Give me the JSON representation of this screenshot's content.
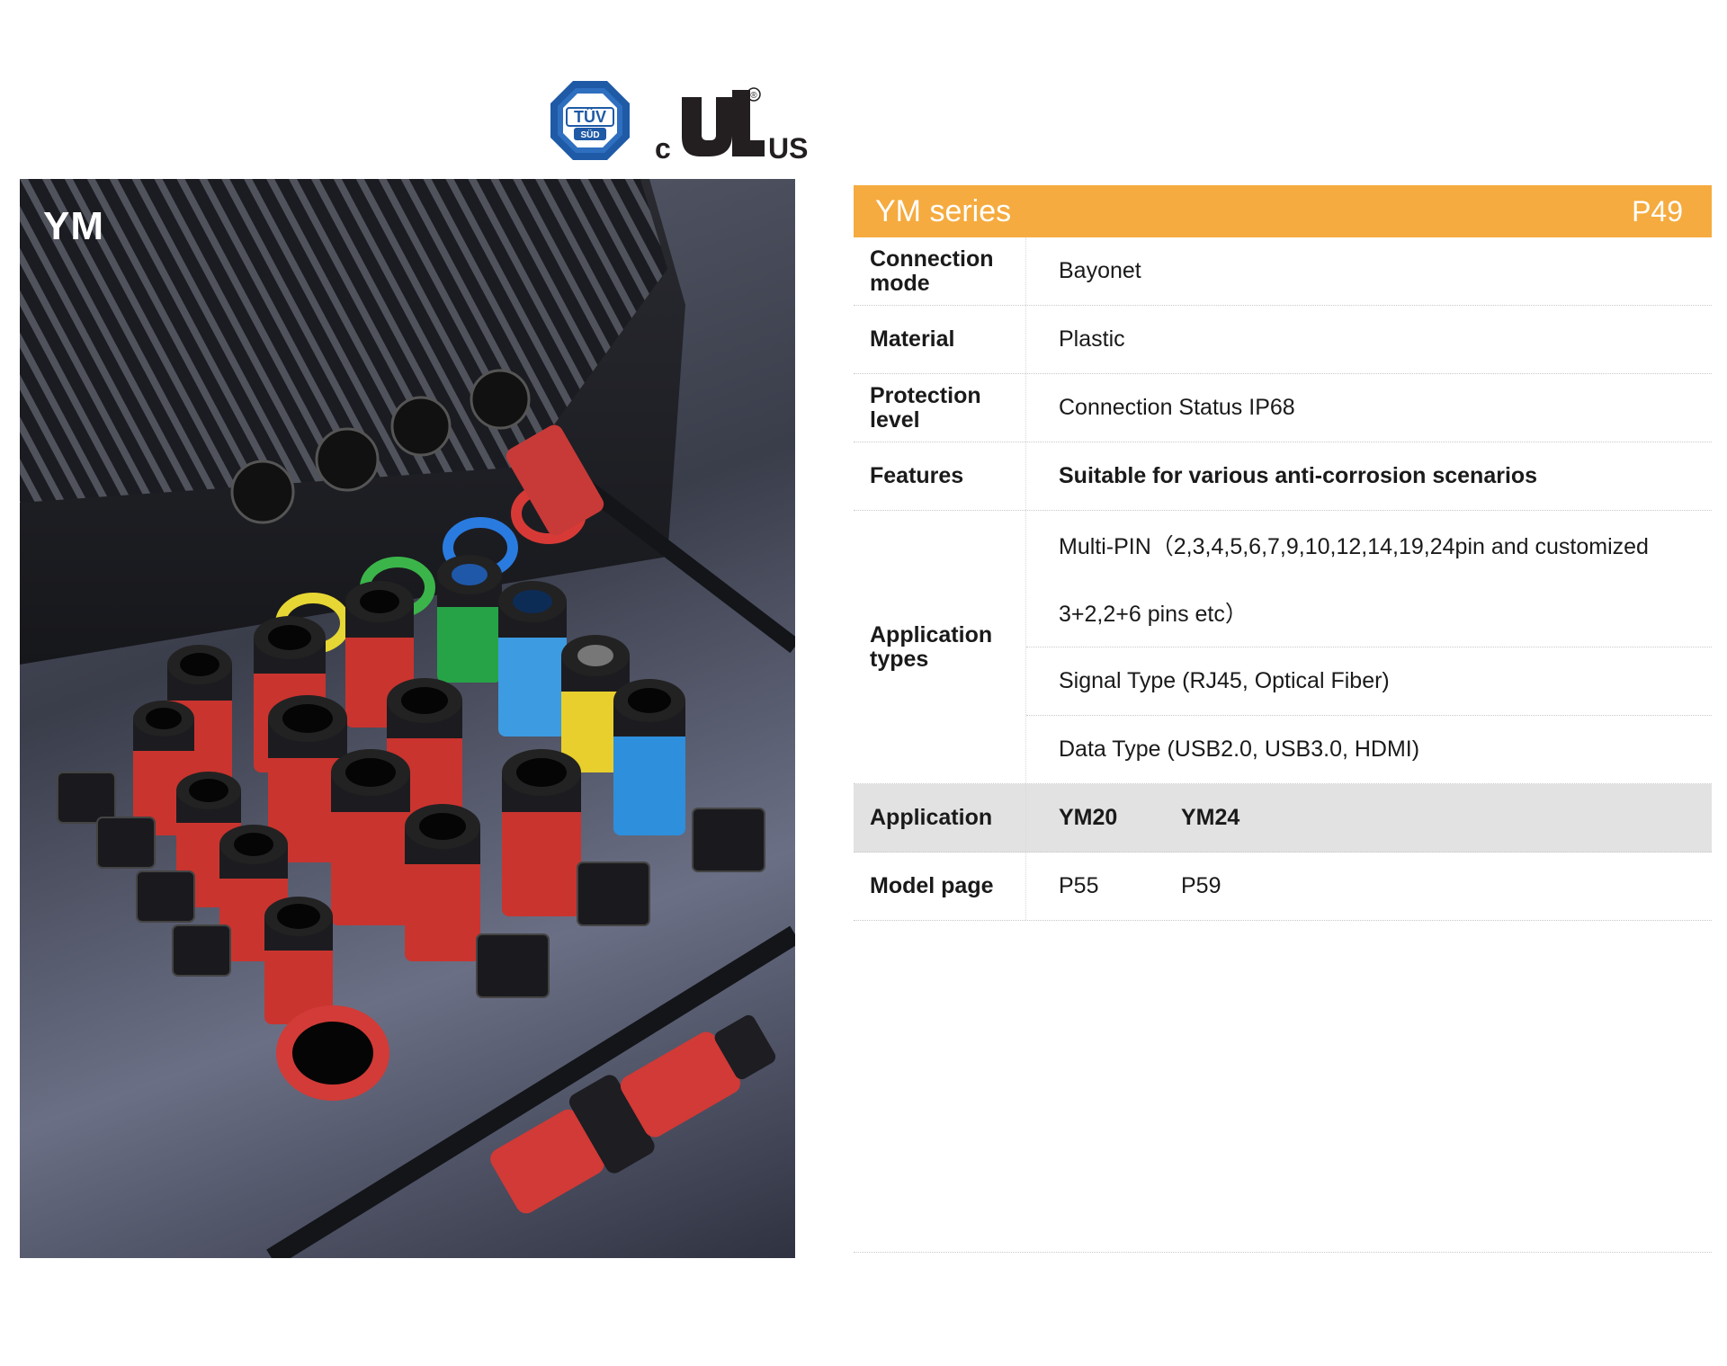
{
  "certifications": {
    "tuv": {
      "line1": "TÜV",
      "line2": "SÜD"
    },
    "ul": {
      "left": "c",
      "right": "US",
      "reg": "®"
    }
  },
  "photo": {
    "label": "YM"
  },
  "spec": {
    "title": "YM series",
    "page": "P49",
    "accent_color": "#f5ab3f",
    "rows": {
      "connection_mode": {
        "label": "Connection mode",
        "value": "Bayonet"
      },
      "material": {
        "label": "Material",
        "value": "Plastic"
      },
      "protection_level": {
        "label": "Protection level",
        "value": "Connection Status IP68"
      },
      "features": {
        "label": "Features",
        "value": "Suitable for various anti-corrosion scenarios"
      },
      "application_types": {
        "label": "Application types",
        "values": [
          "Multi-PIN（2,3,4,5,6,7,9,10,12,14,19,24pin and customized",
          "3+2,2+6 pins etc）",
          "Signal Type (RJ45, Optical Fiber)",
          "Data Type (USB2.0, USB3.0, HDMI)"
        ]
      },
      "application": {
        "label": "Application",
        "values": [
          "YM20",
          "YM24"
        ]
      },
      "model_page": {
        "label": "Model page",
        "values": [
          "P55",
          "P59"
        ]
      }
    }
  }
}
